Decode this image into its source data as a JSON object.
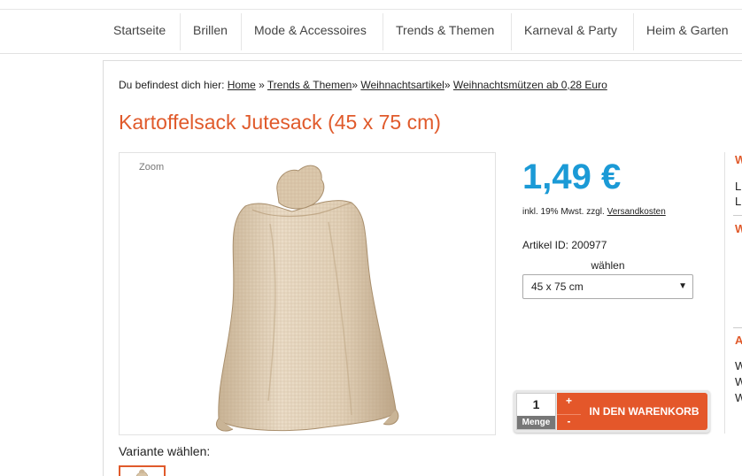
{
  "nav": {
    "items": [
      "Startseite",
      "Brillen",
      "Mode & Accessoires",
      "Trends & Themen",
      "Karneval & Party",
      "Heim & Garten"
    ]
  },
  "breadcrumb": {
    "prefix": "Du befindest dich hier:",
    "links": [
      "Home",
      "Trends & Themen",
      "Weihnachtsartikel",
      "Weihnachtsmützen ab 0,28 Euro"
    ]
  },
  "product": {
    "title": "Kartoffelsack Jutesack (45 x 75 cm)",
    "zoom_label": "Zoom",
    "price": "1,49 €",
    "tax_text": "inkl. 19% Mwst. zzgl.",
    "shipping_link": "Versandkosten",
    "article_id": "Artikel ID: 200977",
    "select_label": "wählen",
    "selected_option": "45 x 75 cm",
    "variant_label": "Variante wählen:"
  },
  "cart": {
    "quantity": "1",
    "quantity_label": "Menge",
    "plus": "+",
    "minus": "-",
    "button_label": "IN DEN WARENKORB"
  },
  "right_column": {
    "h1": "W",
    "l1": "L",
    "l2": "L",
    "h2": "W",
    "h3": "A",
    "w1": "W",
    "w2": "W",
    "w3": "W"
  },
  "colors": {
    "accent": "#e05a2b",
    "price": "#1b9ad6",
    "button": "#e4572a"
  },
  "icons": {
    "select_arrow": "triangle-down"
  }
}
